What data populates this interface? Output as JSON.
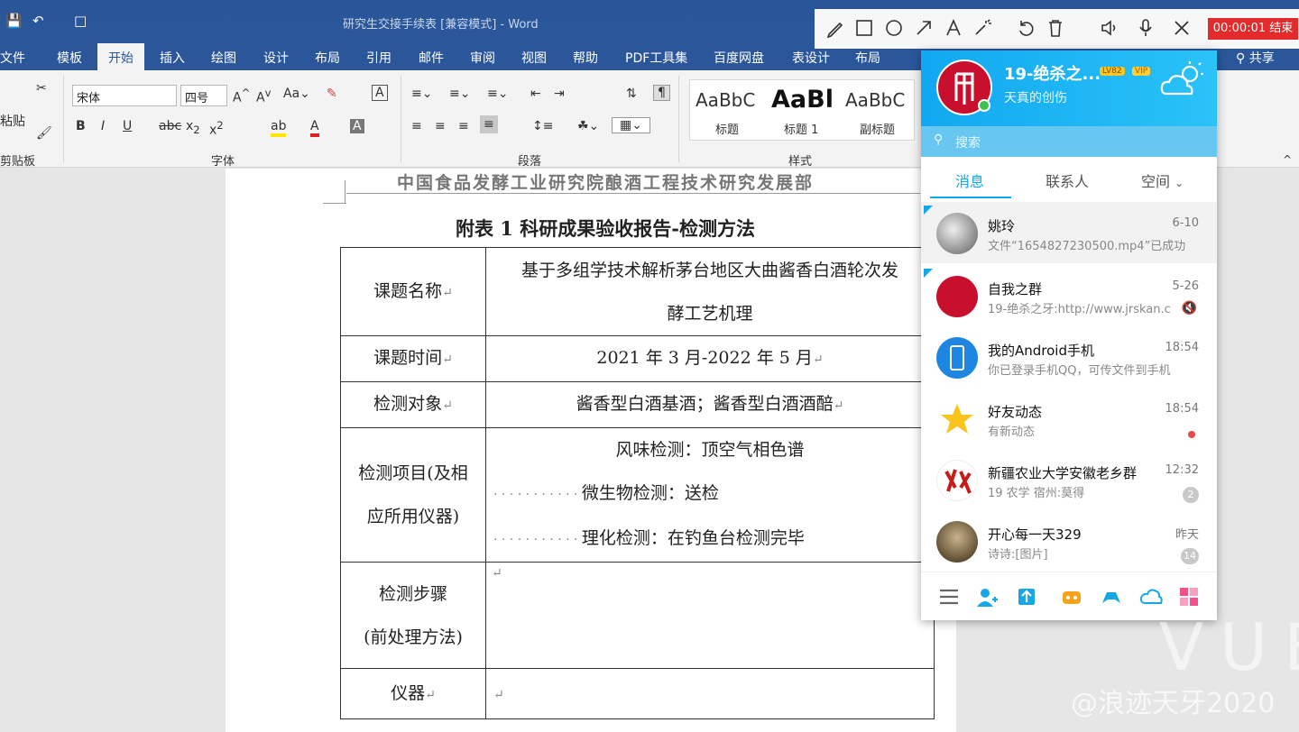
{
  "window": {
    "title": "研究生交接手续表 [兼容模式] - Word"
  },
  "ribbon_tabs": [
    {
      "label": "文件"
    },
    {
      "label": "模板"
    },
    {
      "label": "开始"
    },
    {
      "label": "插入"
    },
    {
      "label": "绘图"
    },
    {
      "label": "设计"
    },
    {
      "label": "布局"
    },
    {
      "label": "引用"
    },
    {
      "label": "邮件"
    },
    {
      "label": "审阅"
    },
    {
      "label": "视图"
    },
    {
      "label": "帮助"
    },
    {
      "label": "PDF工具集"
    },
    {
      "label": "百度网盘"
    },
    {
      "label": "表设计"
    },
    {
      "label": "布局"
    }
  ],
  "share_label": "共享",
  "ribbon": {
    "paste_label": "粘贴",
    "clipboard_group": "剪贴板",
    "font_group": "字体",
    "paragraph_group": "段落",
    "styles_group": "样式",
    "font_name": "宋体",
    "font_size": "四号",
    "styles": [
      {
        "preview": "AaBbC",
        "name": "标题"
      },
      {
        "preview": "AaBl",
        "name": "标题 1"
      },
      {
        "preview": "AaBbC",
        "name": "副标题"
      }
    ]
  },
  "document": {
    "header": "中国食品发酵工业研究院酿酒工程技术研究发展部",
    "title": "附表 1 科研成果验收报告-检测方法",
    "rows": [
      {
        "label": "课题名称",
        "value_lines": [
          "基于多组学技术解析茅台地区大曲酱香白酒轮次发",
          "酵工艺机理"
        ]
      },
      {
        "label": "课题时间",
        "value_lines": [
          "2021 年 3 月-2022 年 5 月"
        ]
      },
      {
        "label": "检测对象",
        "value_lines": [
          "酱香型白酒基酒；酱香型白酒酒醅"
        ]
      },
      {
        "label_lines": [
          "检测项目(及相",
          "应所用仪器)"
        ],
        "value_lines": [
          "风味检测：顶空气相色谱",
          "微生物检测：送检",
          "理化检测：在钓鱼台检测完毕"
        ]
      },
      {
        "label_lines": [
          "检测步骤",
          "(前处理方法)"
        ],
        "value_lines": [
          ""
        ]
      },
      {
        "label": "仪器",
        "value_lines": [
          ""
        ]
      }
    ]
  },
  "qq": {
    "nickname": "19-绝杀之...",
    "level_badge": "LV82",
    "vip_badge": "VIP",
    "signature": "天真的创伤",
    "search_placeholder": "搜索",
    "tabs": [
      {
        "label": "消息"
      },
      {
        "label": "联系人"
      },
      {
        "label": "空间"
      }
    ],
    "chats": [
      {
        "name": "姚玲",
        "preview": "文件“1654827230500.mp4”已成功",
        "time": "6-10",
        "badge": ""
      },
      {
        "name": "自我之群",
        "preview": "19-绝杀之牙:http://www.jrskan.c",
        "time": "5-26",
        "badge": ""
      },
      {
        "name": "我的Android手机",
        "preview": "你已登录手机QQ，可传文件到手机",
        "time": "18:54",
        "badge": ""
      },
      {
        "name": "好友动态",
        "preview": "有新动态",
        "time": "18:54",
        "badge": ""
      },
      {
        "name": "新疆农业大学安徽老乡群",
        "preview": "19  农学 宿州:莫得",
        "time": "12:32",
        "badge": "2"
      },
      {
        "name": "开心每一天329",
        "preview": "诗诗:[图片]",
        "time": "昨天",
        "badge": "14"
      }
    ]
  },
  "recorder": {
    "timer_label": "00:00:01 结束"
  },
  "watermark": {
    "brand": "VUE",
    "author": "@浪迹天牙2020"
  },
  "colors": {
    "word_blue": "#2b579a",
    "qq_blue": "#12a8f0",
    "record_red": "#e32b2b"
  }
}
